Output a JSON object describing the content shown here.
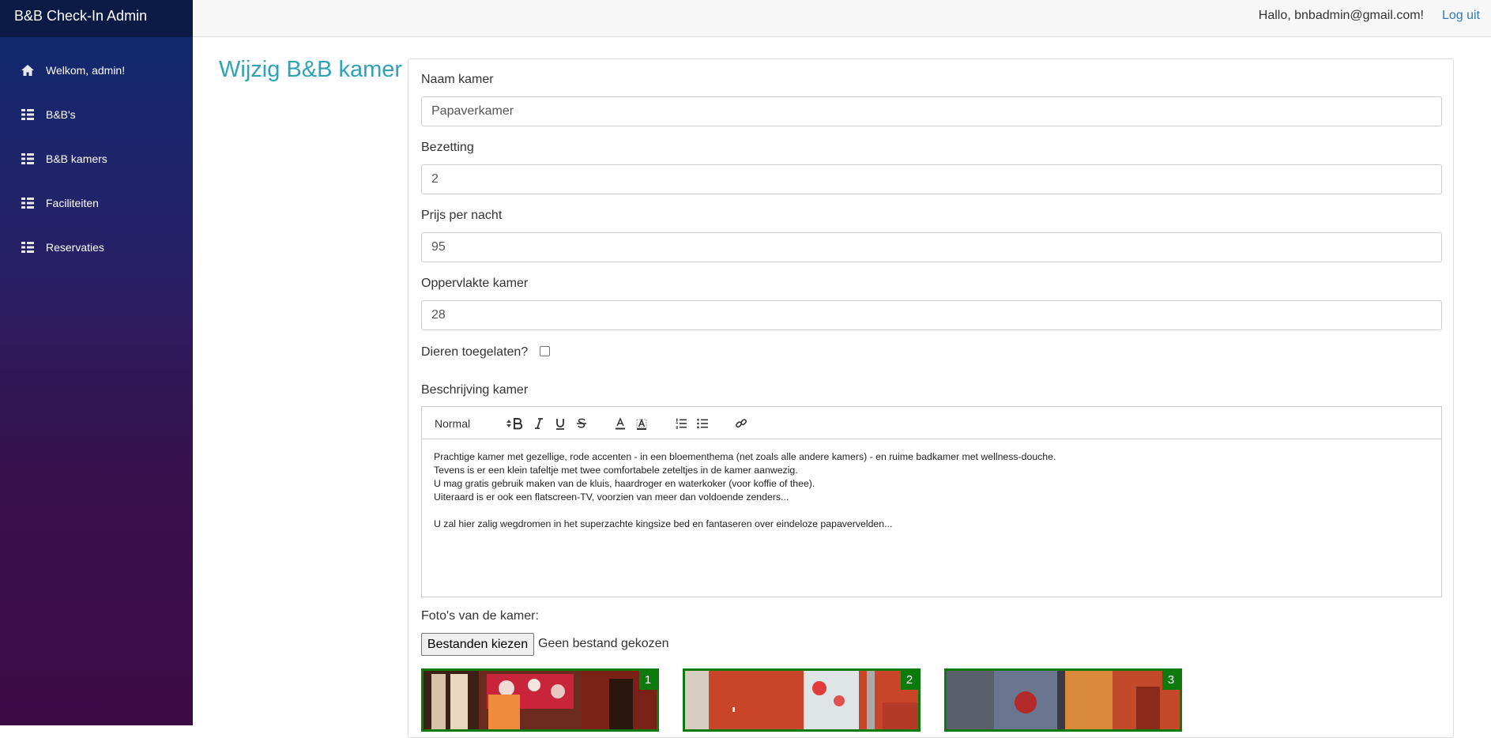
{
  "app": {
    "brand": "B&B Check-In Admin"
  },
  "sidebar": {
    "items": [
      {
        "label": "Welkom, admin!",
        "icon": "home-icon"
      },
      {
        "label": "B&B's",
        "icon": "list-icon"
      },
      {
        "label": "B&B kamers",
        "icon": "list-icon"
      },
      {
        "label": "Faciliteiten",
        "icon": "list-icon"
      },
      {
        "label": "Reservaties",
        "icon": "list-icon"
      }
    ]
  },
  "header": {
    "greeting": "Hallo, bnbadmin@gmail.com!",
    "logout": "Log uit"
  },
  "page": {
    "title": "Wijzig B&B kamer"
  },
  "form": {
    "name_label": "Naam kamer",
    "name_value": "Papaverkamer",
    "occupancy_label": "Bezetting",
    "occupancy_value": "2",
    "price_label": "Prijs per nacht",
    "price_value": "95",
    "area_label": "Oppervlakte kamer",
    "area_value": "28",
    "pets_label": "Dieren toegelaten?",
    "pets_checked": false,
    "description_label": "Beschrijving kamer",
    "editor": {
      "format_select": "Normal",
      "lines": [
        "Prachtige kamer met gezellige, rode accenten - in een bloementhema (net zoals alle andere kamers) - en ruime badkamer met wellness-douche.",
        "Tevens is er een klein tafeltje met twee comfortabele zeteltjes in de kamer aanwezig.",
        "U mag gratis gebruik maken van de kluis, haardroger en waterkoker (voor koffie of thee).",
        "Uiteraard is er ook een flatscreen-TV, voorzien van meer dan voldoende zenders...",
        "",
        "U zal hier zalig wegdromen in het superzachte kingsize bed en fantaseren over eindeloze papavervelden..."
      ]
    },
    "photos_label": "Foto's van de kamer:",
    "file_button": "Bestanden kiezen",
    "file_status": "Geen bestand gekozen",
    "photos": [
      {
        "badge": "1"
      },
      {
        "badge": "2"
      },
      {
        "badge": "3"
      }
    ]
  },
  "colors": {
    "accent": "#2ea3b6",
    "link": "#337ab7",
    "photo_border": "#0c7a0c"
  }
}
